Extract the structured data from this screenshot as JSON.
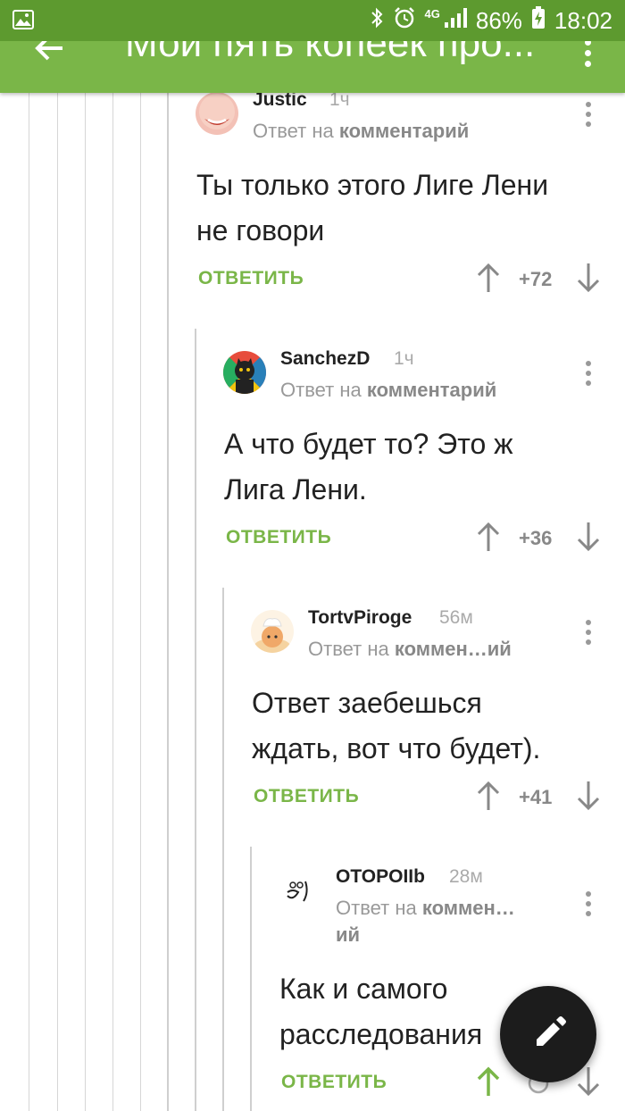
{
  "status_bar": {
    "network": "4G",
    "battery": "86%",
    "time": "18:02"
  },
  "app_bar": {
    "title": "Мои пять копеек про..."
  },
  "comments": [
    {
      "author": "Justic",
      "time": "1ч",
      "reply_prefix": "Ответ на",
      "reply_target": "комментарий",
      "text_lines": [
        "Ты только этого Лиге Лени",
        "не говори"
      ],
      "reply_label": "ОТВЕТИТЬ",
      "score": "+72"
    },
    {
      "author": "SanchezD",
      "time": "1ч",
      "reply_prefix": "Ответ на",
      "reply_target": "комментарий",
      "text_lines": [
        "А что будет то? Это ж",
        "Лига Лени."
      ],
      "reply_label": "ОТВЕТИТЬ",
      "score": "+36"
    },
    {
      "author": "TortvPiroge",
      "time": "56м",
      "reply_prefix": "Ответ на",
      "reply_target": "коммен…ий",
      "text_lines": [
        "Ответ заебешься",
        "ждать, вот что будет)."
      ],
      "reply_label": "ОТВЕТИТЬ",
      "score": "+41"
    },
    {
      "author": "OTOPOIIb",
      "time": "28м",
      "reply_prefix": "Ответ на",
      "reply_target": "коммен…",
      "reply_target_tail": "ий",
      "text_lines": [
        "Как и самого",
        "расследования"
      ],
      "reply_label": "ОТВЕТИТЬ",
      "score": ""
    }
  ],
  "colors": {
    "status_bar": "#5d9a2f",
    "app_bar": "#7ab648",
    "accent": "#7ab648",
    "fab": "#1c1c1c"
  },
  "icons": {
    "status_left": "image-notification-icon",
    "fab": "pencil-icon"
  }
}
